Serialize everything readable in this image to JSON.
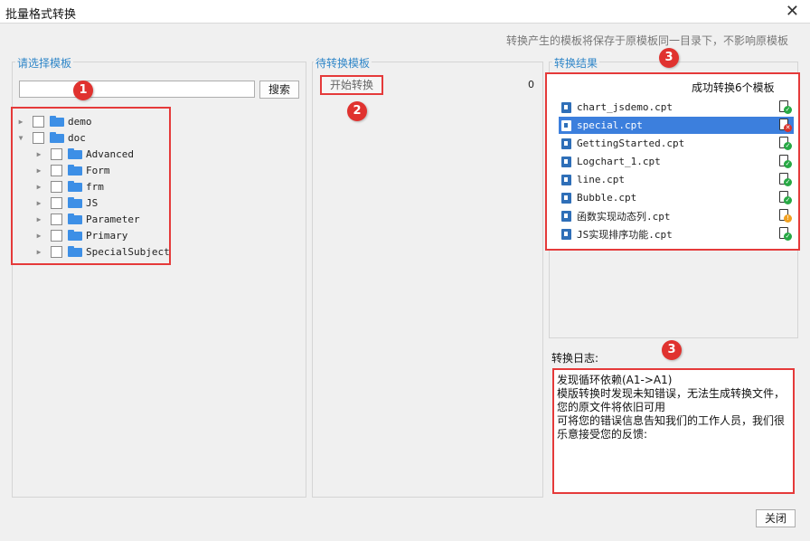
{
  "window": {
    "title": "批量格式转换",
    "close_glyph": "✕"
  },
  "hint": "转换产生的模板将保存于原模板同一目录下，不影响原模板",
  "left_panel": {
    "title": "请选择模板",
    "search_value": "",
    "search_button": "搜索",
    "tree": [
      {
        "label": "demo",
        "expanded": false,
        "level": 0
      },
      {
        "label": "doc",
        "expanded": true,
        "level": 0
      },
      {
        "label": "Advanced",
        "expanded": false,
        "level": 1
      },
      {
        "label": "Form",
        "expanded": false,
        "level": 1
      },
      {
        "label": "frm",
        "expanded": false,
        "level": 1
      },
      {
        "label": "JS",
        "expanded": false,
        "level": 1
      },
      {
        "label": "Parameter",
        "expanded": false,
        "level": 1
      },
      {
        "label": "Primary",
        "expanded": false,
        "level": 1
      },
      {
        "label": "SpecialSubject",
        "expanded": false,
        "level": 1
      }
    ]
  },
  "middle_panel": {
    "title": "待转换模板",
    "start_button": "开始转换",
    "count": "0"
  },
  "right_panel": {
    "title": "转换结果",
    "header": "成功转换6个模板",
    "files": [
      {
        "name": "chart_jsdemo.cpt",
        "status": "success",
        "selected": false
      },
      {
        "name": "special.cpt",
        "status": "error",
        "selected": true
      },
      {
        "name": "GettingStarted.cpt",
        "status": "success",
        "selected": false
      },
      {
        "name": "Logchart_1.cpt",
        "status": "success",
        "selected": false
      },
      {
        "name": "line.cpt",
        "status": "success",
        "selected": false
      },
      {
        "name": "Bubble.cpt",
        "status": "success",
        "selected": false
      },
      {
        "name": "函数实现动态列.cpt",
        "status": "warning",
        "selected": false
      },
      {
        "name": "JS实现排序功能.cpt",
        "status": "success",
        "selected": false
      }
    ],
    "log_label": "转换日志:",
    "log_text": "发现循环依赖(A1->A1)\n模版转换时发现未知错误，无法生成转换文件，您的原文件将依旧可用\n可将您的错误信息告知我们的工作人员，我们很乐意接受您的反馈:"
  },
  "annotations": [
    "1",
    "2",
    "3",
    "3"
  ],
  "close_button": "关闭",
  "colors": {
    "accent": "#2f86c8",
    "highlight": "#e53a3a",
    "selection": "#3c7fdd",
    "success": "#27a844",
    "error": "#d9322b",
    "warning": "#f0a020"
  }
}
